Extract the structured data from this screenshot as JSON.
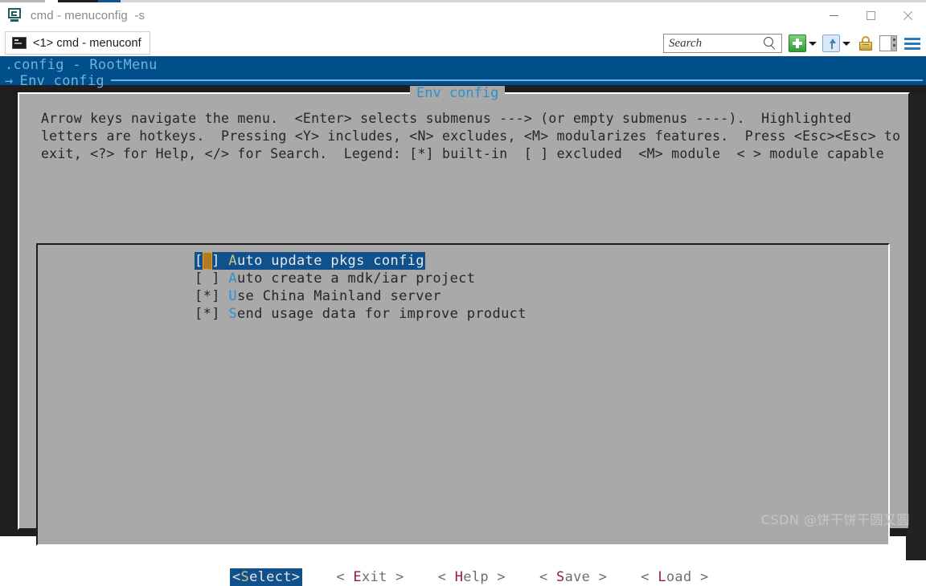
{
  "window": {
    "title": "cmd - menuconfig  -s",
    "app_icon": "console-app-icon",
    "minimize_label": "Minimize",
    "maximize_label": "Maximize",
    "close_label": "Close"
  },
  "tabstrip": {
    "tab": {
      "icon": "terminal-icon",
      "label": "<1> cmd - menuconf"
    },
    "toolbar": {
      "search_placeholder": "Search",
      "search_value": "",
      "search_icon": "magnifier-icon",
      "new_tab_icon": "green-plus-icon",
      "new_tab_caret_icon": "chevron-down-icon",
      "split_icon": "split-pane-icon",
      "split_caret_icon": "chevron-down-icon",
      "lock_icon": "lock-icon",
      "panel_icon": "panel-layout-icon",
      "menu_icon": "hamburger-menu-icon"
    }
  },
  "breadcrumb": {
    "line1": ".config - RootMenu",
    "line2_arrow": "→",
    "line2": "Env config"
  },
  "dialog": {
    "title": "Env config",
    "help_lines": [
      "Arrow keys navigate the menu.  <Enter> selects submenus ---> (or empty submenus ----).  Highlighted",
      "letters are hotkeys.  Pressing <Y> includes, <N> excludes, <M> modularizes features.  Press <Esc><Esc> to",
      "exit, <?> for Help, </> for Search.  Legend: [*] built-in  [ ] excluded  <M> module  < > module capable"
    ]
  },
  "menu": {
    "items": [
      {
        "checkbox_open": "[",
        "checkbox_state": " ",
        "checkbox_close": "]",
        "hotkey": "A",
        "rest": "uto update pkgs config",
        "selected": true,
        "checked": false
      },
      {
        "checkbox_open": "[",
        "checkbox_state": " ",
        "checkbox_close": "]",
        "hotkey": "A",
        "rest": "uto create a mdk/iar project",
        "selected": false,
        "checked": false
      },
      {
        "checkbox_open": "[",
        "checkbox_state": "*",
        "checkbox_close": "]",
        "hotkey": "U",
        "rest": "se China Mainland server",
        "selected": false,
        "checked": true
      },
      {
        "checkbox_open": "[",
        "checkbox_state": "*",
        "checkbox_close": "]",
        "hotkey": "S",
        "rest": "end usage data for improve product",
        "selected": false,
        "checked": true
      }
    ]
  },
  "buttons": [
    {
      "prefix": "<",
      "hotkey": "S",
      "rest": "elect",
      "suffix": ">",
      "active": true
    },
    {
      "prefix": "< ",
      "hotkey": "E",
      "rest": "xit",
      "suffix": " >",
      "active": false
    },
    {
      "prefix": "< ",
      "hotkey": "H",
      "rest": "elp",
      "suffix": " >",
      "active": false
    },
    {
      "prefix": "< ",
      "hotkey": "S",
      "rest": "ave",
      "suffix": " >",
      "active": false
    },
    {
      "prefix": "< ",
      "hotkey": "L",
      "rest": "oad",
      "suffix": " >",
      "active": false
    }
  ],
  "watermark": "CSDN @饼干饼干圆又圆",
  "colors": {
    "header_blue": "#004f8b",
    "dialog_gray": "#a9a9a9",
    "terminal_bg": "#1e1e1e",
    "accent_blue": "#2f8fd0",
    "highlight_blue": "#10518c",
    "hotkey_red": "#9b1a3c",
    "hotkey_yellow": "#c8c484"
  }
}
